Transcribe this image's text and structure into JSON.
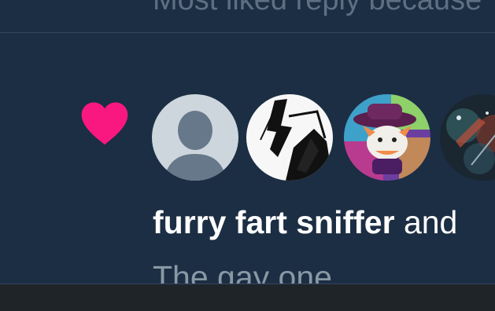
{
  "previous_item": {
    "text": "Most liked reply because"
  },
  "notification": {
    "type_icon": "heart-icon",
    "type_color": "#f91880",
    "avatars": [
      {
        "description": "default-profile-avatar"
      },
      {
        "description": "black-white-abstract-avatar"
      },
      {
        "description": "cartoon-cat-purple-hat-avatar"
      },
      {
        "description": "dark-colorful-photo-avatar"
      }
    ],
    "user_name": "furry fart sniffer",
    "conjunction": " and",
    "tweet_text": "The gay one"
  }
}
